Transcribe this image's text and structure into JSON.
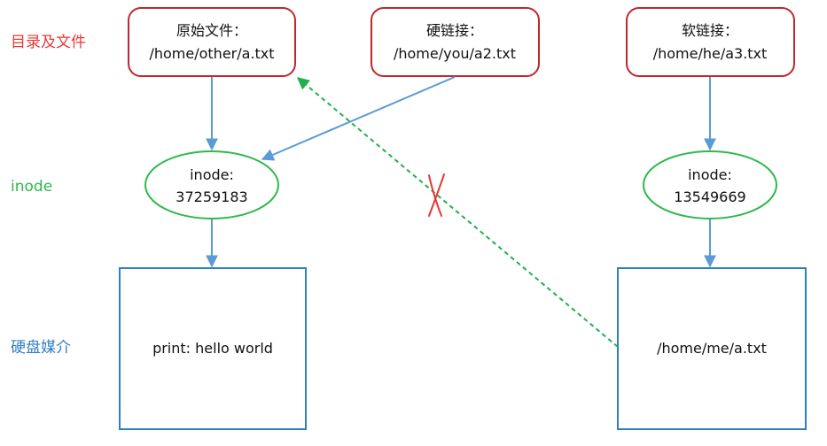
{
  "row_labels": {
    "directory": {
      "text": "目录及文件",
      "color": "#e53935"
    },
    "inode": {
      "text": "inode",
      "color": "#2eb84a"
    },
    "disk": {
      "text": "硬盘媒介",
      "color": "#2f7fc1"
    }
  },
  "file_nodes": {
    "original": {
      "line1": "原始文件：",
      "line2": "/home/other/a.txt"
    },
    "hardlink": {
      "line1": "硬链接：",
      "line2": "/home/you/a2.txt"
    },
    "softlink": {
      "line1": "软链接：",
      "line2": "/home/he/a3.txt"
    }
  },
  "inode_nodes": {
    "original": {
      "line1": "inode:",
      "line2": "37259183"
    },
    "softlink": {
      "line1": "inode:",
      "line2": "13549669"
    }
  },
  "disk_blocks": {
    "original": {
      "text": "print: hello world"
    },
    "softlink": {
      "text": "/home/me/a.txt"
    }
  },
  "colors": {
    "file_border": "#c0272d",
    "inode_border": "#2eb84a",
    "disk_border": "#2f7fc1",
    "arrow_blue": "#5b9bd5",
    "arrow_green_dashed": "#22b04a",
    "cross_mark": "#e53935"
  }
}
